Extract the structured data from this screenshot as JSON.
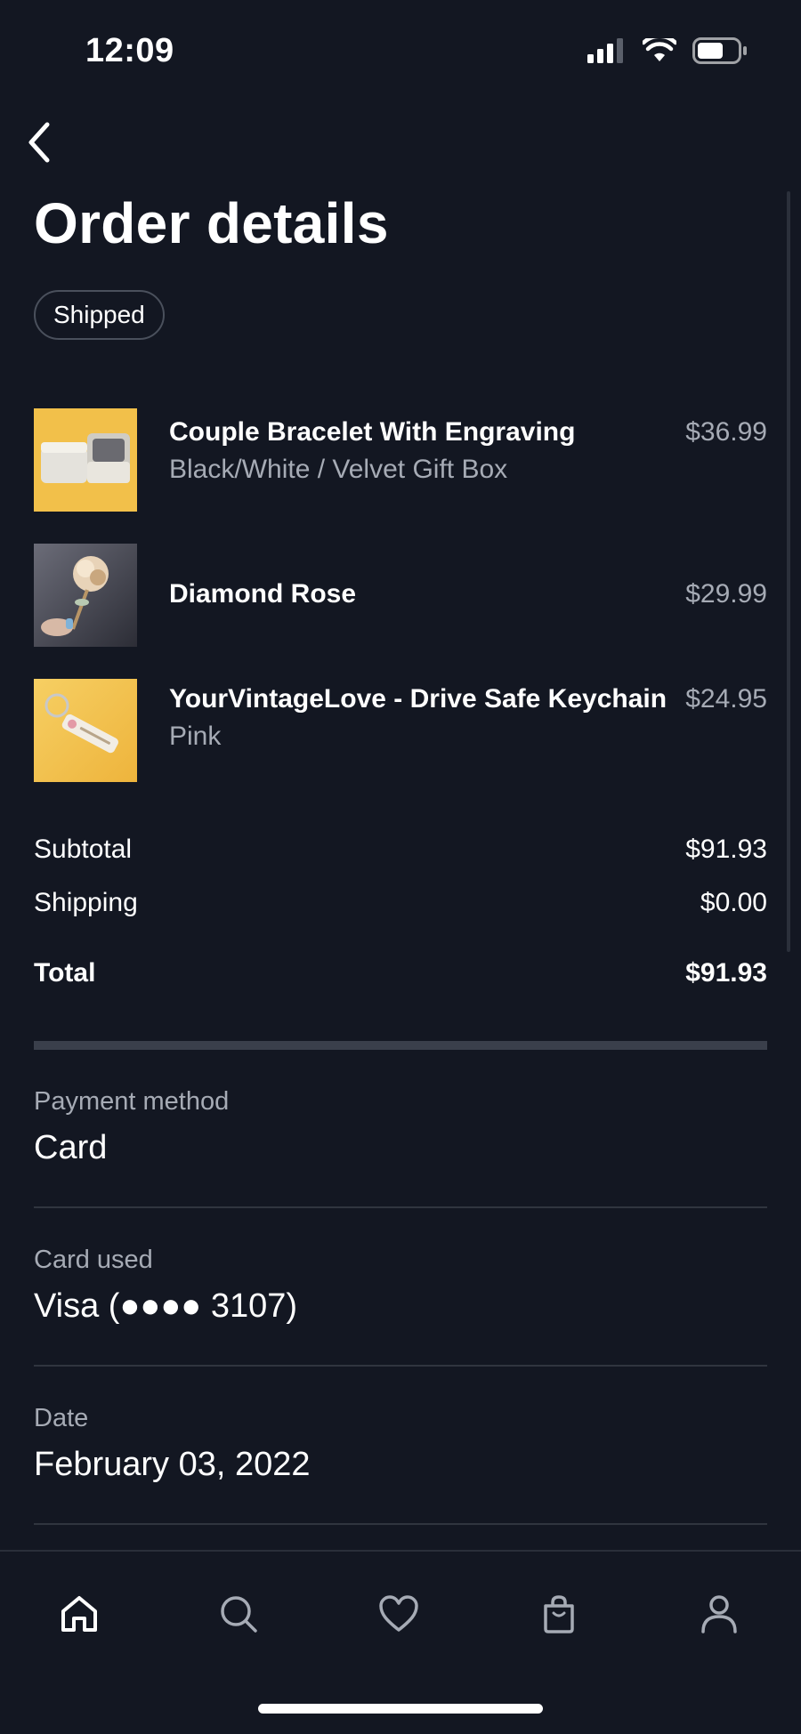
{
  "status_bar": {
    "time": "12:09"
  },
  "header": {
    "title": "Order details",
    "status": "Shipped"
  },
  "items": [
    {
      "name": "Couple Bracelet With Engraving",
      "variant": "Black/White / Velvet Gift Box",
      "price": "$36.99",
      "thumb_bg": "#f2c04a"
    },
    {
      "name": "Diamond Rose",
      "variant": "",
      "price": "$29.99",
      "thumb_bg": "#3d3e4a"
    },
    {
      "name": "YourVintageLove - Drive Safe Keychain",
      "variant": "Pink",
      "price": "$24.95",
      "thumb_bg": "#f3c24c"
    }
  ],
  "summary": {
    "subtotal_label": "Subtotal",
    "subtotal_value": "$91.93",
    "shipping_label": "Shipping",
    "shipping_value": "$0.00",
    "total_label": "Total",
    "total_value": "$91.93"
  },
  "details": {
    "payment_label": "Payment method",
    "payment_value": "Card",
    "card_label": "Card used",
    "card_value": "Visa (●●●● 3107)",
    "date_label": "Date",
    "date_value": "February 03, 2022"
  },
  "tab_bar": {
    "tabs": [
      "home-icon",
      "search-icon",
      "heart-icon",
      "bag-icon",
      "profile-icon"
    ]
  },
  "colors": {
    "background": "#131722",
    "text_primary": "#ffffff",
    "text_secondary": "#a6abb5",
    "divider": "#30353f"
  }
}
